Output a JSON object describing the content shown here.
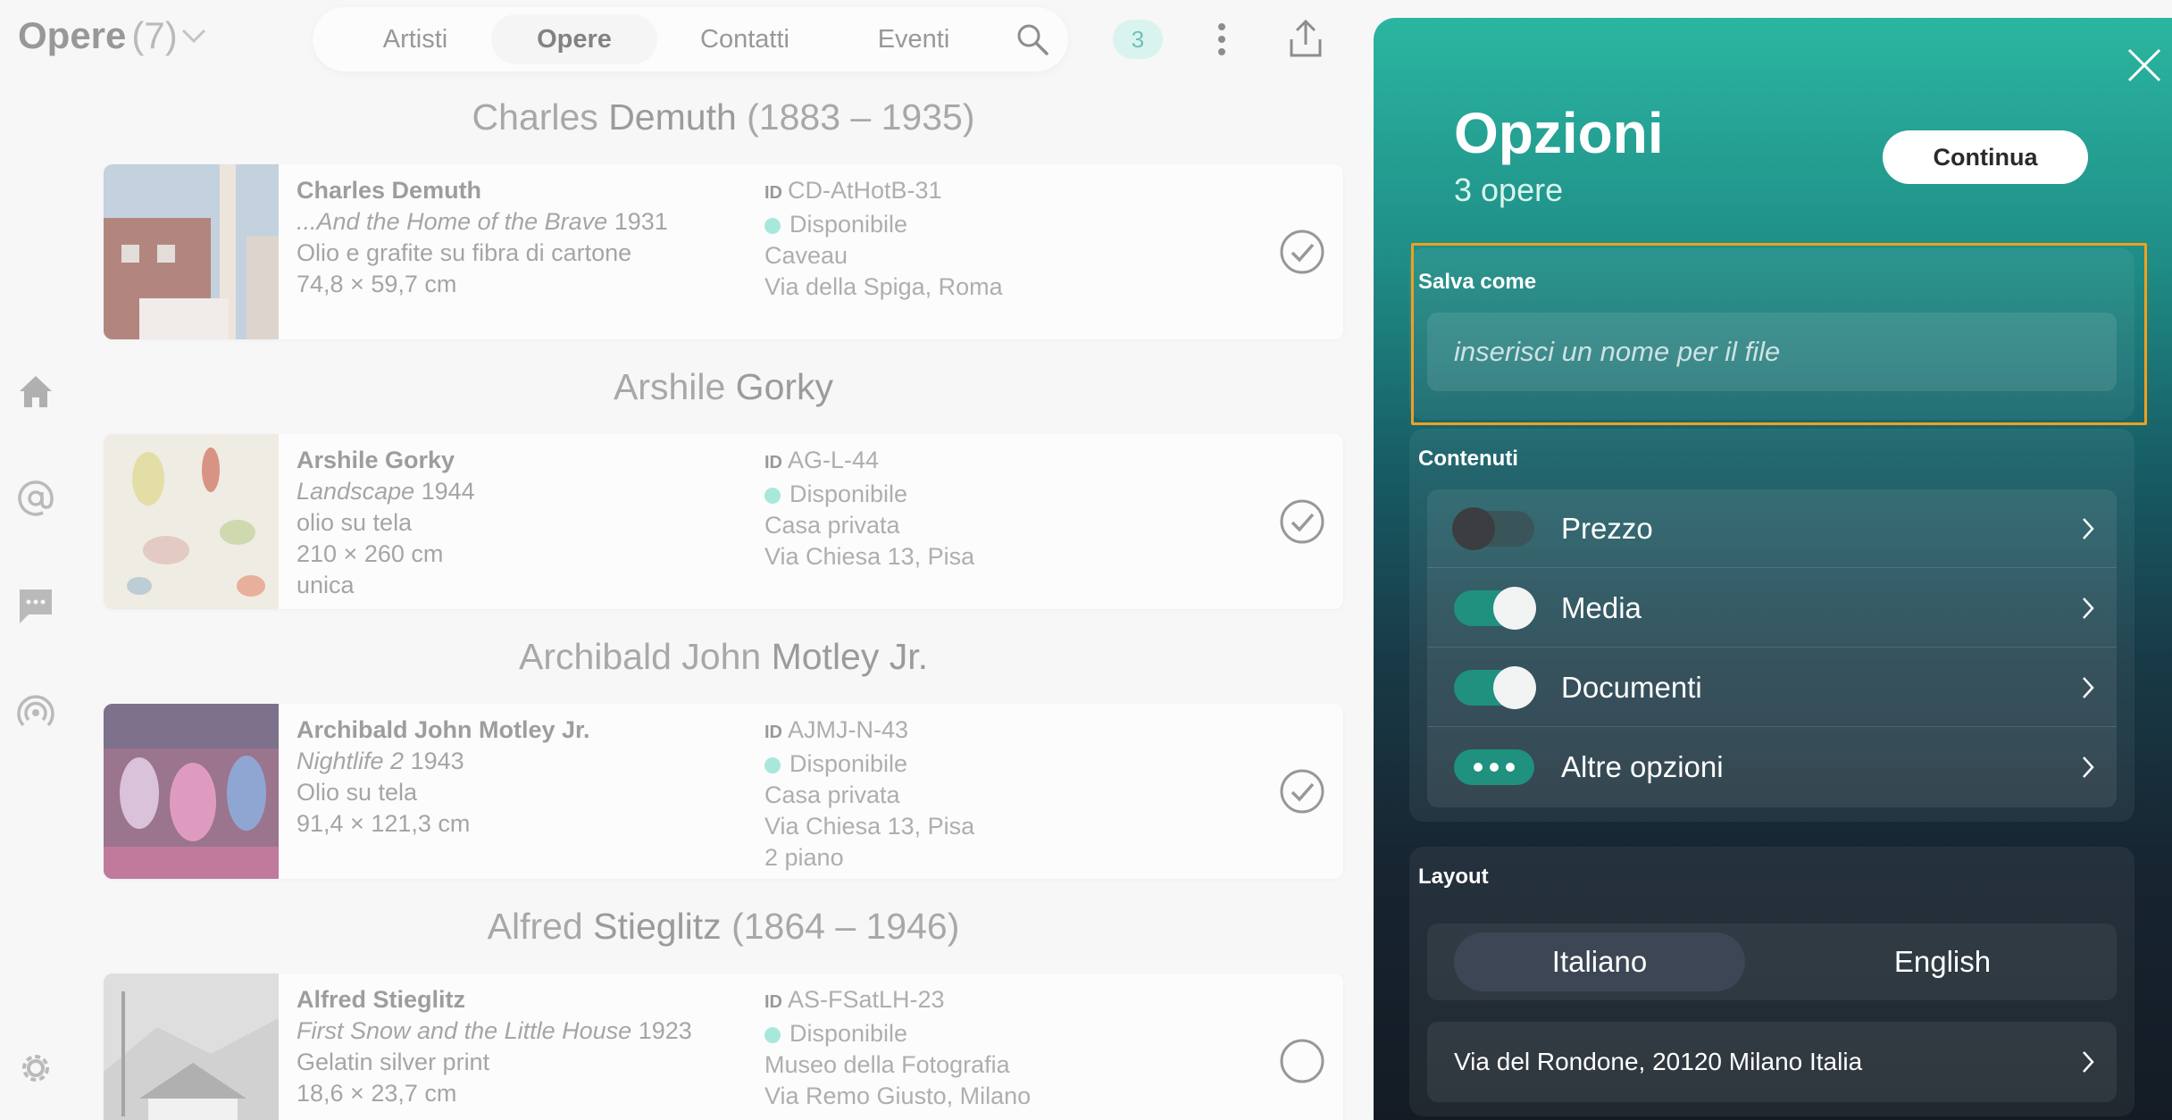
{
  "header": {
    "title": "Opere",
    "count": "(7)",
    "tabs": [
      {
        "label": "Artisti",
        "active": false
      },
      {
        "label": "Opere",
        "active": true
      },
      {
        "label": "Contatti",
        "active": false
      },
      {
        "label": "Eventi",
        "active": false
      }
    ],
    "selection_count": "3"
  },
  "rail": [
    "home-icon",
    "at-icon",
    "chat-icon",
    "broadcast-icon",
    "gear-icon"
  ],
  "artists": [
    {
      "heading_first": "Charles ",
      "heading_last": "Demuth",
      "heading_dates": " (1883 – 1935)",
      "artwork": {
        "artist": "Charles Demuth",
        "title": "...And the Home of the Brave",
        "year": " 1931",
        "lines": [
          "Olio e grafite su fibra di cartone",
          "74,8 × 59,7 cm"
        ],
        "id": "CD-AtHotB-31",
        "status": "Disponibile",
        "location": [
          "Caveau",
          "Via della Spiga, Roma"
        ],
        "selected": true
      }
    },
    {
      "heading_first": "Arshile ",
      "heading_last": "Gorky",
      "heading_dates": "",
      "artwork": {
        "artist": "Arshile Gorky",
        "title": "Landscape",
        "year": " 1944",
        "lines": [
          "olio su tela",
          "210 × 260 cm",
          "unica"
        ],
        "id": "AG-L-44",
        "status": "Disponibile",
        "location": [
          "Casa privata",
          "Via Chiesa 13, Pisa"
        ],
        "selected": true
      }
    },
    {
      "heading_first": "Archibald John ",
      "heading_last": "Motley Jr.",
      "heading_dates": "",
      "artwork": {
        "artist": "Archibald John Motley Jr.",
        "title": "Nightlife 2",
        "year": " 1943",
        "lines": [
          "Olio su tela",
          "91,4 × 121,3 cm"
        ],
        "id": "AJMJ-N-43",
        "status": "Disponibile",
        "location": [
          "Casa privata",
          "Via Chiesa 13, Pisa",
          "2 piano"
        ],
        "selected": true
      }
    },
    {
      "heading_first": "Alfred ",
      "heading_last": "Stieglitz",
      "heading_dates": " (1864 – 1946)",
      "artwork": {
        "artist": "Alfred Stieglitz",
        "title": "First Snow and the Little House",
        "year": " 1923",
        "lines": [
          "Gelatin silver print",
          "18,6 × 23,7 cm"
        ],
        "id": "AS-FSatLH-23",
        "status": "Disponibile",
        "location": [
          "Museo della Fotografia",
          "Via Remo Giusto, Milano"
        ],
        "selected": false
      }
    }
  ],
  "id_label": "ID",
  "panel": {
    "title": "Opzioni",
    "subtitle": "3 opere",
    "continue_label": "Continua",
    "save_as": {
      "label": "Salva come",
      "placeholder": "inserisci un nome per il file",
      "value": ""
    },
    "contents": {
      "label": "Contenuti",
      "options": [
        {
          "label": "Prezzo",
          "state": "off"
        },
        {
          "label": "Media",
          "state": "on"
        },
        {
          "label": "Documenti",
          "state": "on"
        },
        {
          "label": "Altre opzioni",
          "state": "more"
        }
      ]
    },
    "layout": {
      "label": "Layout",
      "languages": [
        {
          "label": "Italiano",
          "active": true
        },
        {
          "label": "English",
          "active": false
        }
      ],
      "address": "Via del Rondone, 20120 Milano Italia"
    }
  },
  "colors": {
    "accent": "#2bb6a1",
    "status_available": "#7fe0cd",
    "highlight_frame": "#f0a020"
  }
}
